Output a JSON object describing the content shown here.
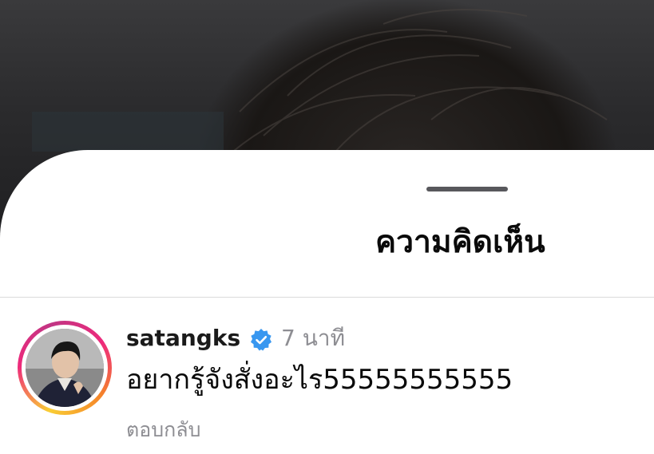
{
  "sheet": {
    "title": "ความคิดเห็น"
  },
  "comment": {
    "username": "satangks",
    "verified_icon": "verified-badge-icon",
    "time": "7 นาที",
    "text": "อยากรู้จังสั่งอะไร55555555555",
    "reply_label": "ตอบกลับ"
  },
  "colors": {
    "verified": "#3897f0",
    "muted": "#8e8e93",
    "ring_start": "#f9ce34",
    "ring_mid": "#ee2a7b",
    "ring_end": "#c13584"
  }
}
